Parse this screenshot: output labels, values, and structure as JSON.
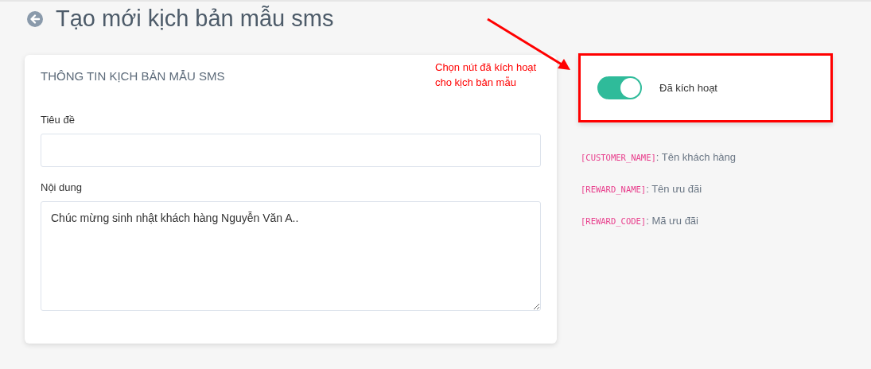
{
  "page": {
    "title": "Tạo mới kịch bản mẫu sms"
  },
  "form": {
    "heading": "THÔNG TIN KỊCH BẢN MẪU SMS",
    "fields": [
      {
        "label": "Tiêu đề",
        "kind": "input"
      },
      {
        "label": "Nội dung",
        "kind": "textarea",
        "value": "Chúc mừng sinh nhật khách hàng Nguyễn Văn A.."
      }
    ]
  },
  "annotation": {
    "text": "Chọn nút đã kích hoạt cho kịch bản mẫu"
  },
  "status": {
    "on": true,
    "label": "Đã kích hoạt"
  },
  "variables": [
    {
      "code": "[CUSTOMER_NAME]",
      "description": ": Tên khách hàng"
    },
    {
      "code": "[REWARD_NAME]",
      "description": ": Tên ưu đãi"
    },
    {
      "code": "[REWARD_CODE]",
      "description": ": Mã ưu đãi"
    }
  ]
}
